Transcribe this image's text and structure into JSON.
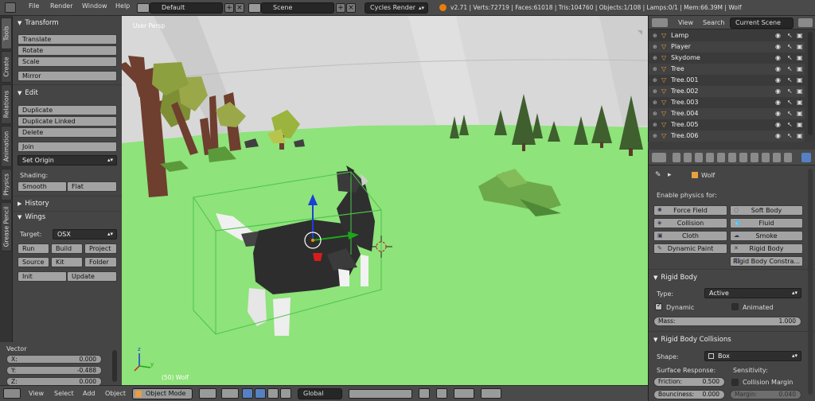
{
  "topbar": {
    "menus": [
      "File",
      "Render",
      "Window",
      "Help"
    ],
    "screen_layout": "Default",
    "scene": "Scene",
    "render_engine": "Cycles Render",
    "stats": "v2.71 | Verts:72719 | Faces:61018 | Tris:104760 | Objects:1/108 | Lamps:0/1 | Mem:66.39M | Wolf"
  },
  "vtabs": [
    "Tools",
    "Create",
    "Relations",
    "Animation",
    "Physics",
    "Grease Pencil"
  ],
  "toolshelf": {
    "transform": {
      "title": "Transform",
      "buttons": [
        "Translate",
        "Rotate",
        "Scale",
        "Mirror"
      ]
    },
    "edit": {
      "title": "Edit",
      "buttons": [
        "Duplicate",
        "Duplicate Linked",
        "Delete",
        "Join"
      ],
      "set_origin": "Set Origin",
      "shading_label": "Shading:",
      "smooth": "Smooth",
      "flat": "Flat"
    },
    "history": {
      "title": "History"
    },
    "wings": {
      "title": "Wings",
      "target_label": "Target:",
      "target_value": "OSX",
      "buttons": [
        "Run",
        "Build",
        "Project",
        "Source",
        "Kit",
        "Folder",
        "Init",
        "Update"
      ]
    }
  },
  "vector": {
    "title": "Vector",
    "x_label": "X:",
    "x_value": "0.000",
    "y_label": "Y:",
    "y_value": "-0.488",
    "z_label": "Z:",
    "z_value": "0.000"
  },
  "viewport": {
    "view_name": "User Persp",
    "object_info": "(50) Wolf"
  },
  "viewport_header": {
    "menus": [
      "View",
      "Select",
      "Add",
      "Object"
    ],
    "mode": "Object Mode",
    "orientation": "Global"
  },
  "outliner": {
    "menus": [
      "View",
      "Search"
    ],
    "scope": "Current Scene",
    "rows": [
      "Lamp",
      "Player",
      "Skydome",
      "Tree",
      "Tree.001",
      "Tree.002",
      "Tree.003",
      "Tree.004",
      "Tree.005",
      "Tree.006"
    ]
  },
  "properties": {
    "object_name": "Wolf",
    "enable_label": "Enable physics for:",
    "physics_buttons_left": [
      "Force Field",
      "Collision",
      "Cloth",
      "Dynamic Paint"
    ],
    "physics_buttons_right": [
      "Soft Body",
      "Fluid",
      "Smoke",
      "Rigid Body",
      "Rigid Body Constra..."
    ],
    "rigid_body": {
      "title": "Rigid Body",
      "type_label": "Type:",
      "type_value": "Active",
      "dynamic": "Dynamic",
      "animated": "Animated",
      "mass_label": "Mass:",
      "mass_value": "1.000"
    },
    "collisions": {
      "title": "Rigid Body Collisions",
      "shape_label": "Shape:",
      "shape_value": "Box",
      "surface_label": "Surface Response:",
      "sensitivity_label": "Sensitivity:",
      "friction_label": "Friction:",
      "friction_value": "0.500",
      "collision_margin": "Collision Margin",
      "bounciness_label": "Bounciness:",
      "bounciness_value": "0.000",
      "margin_label": "Margin:",
      "margin_value": "0.040"
    }
  },
  "colors": {
    "grass": "#8ee37a",
    "sky": "#d9d9d9",
    "panel": "#454545",
    "button": "#a3a3a3",
    "selection_outline": "#4cc44c"
  }
}
